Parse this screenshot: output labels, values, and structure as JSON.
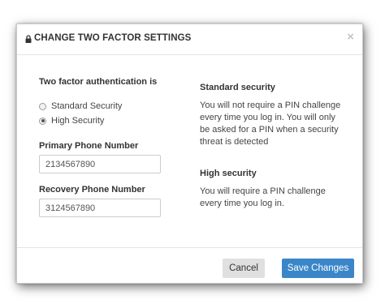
{
  "dialog": {
    "title": "CHANGE TWO FACTOR SETTINGS",
    "close_label": "×",
    "lock_icon": "lock-icon"
  },
  "form": {
    "auth_heading": "Two factor authentication is",
    "options": [
      {
        "label": "Standard Security",
        "selected": false
      },
      {
        "label": "High Security",
        "selected": true
      }
    ],
    "primary_phone": {
      "label": "Primary Phone Number",
      "value": "2134567890"
    },
    "recovery_phone": {
      "label": "Recovery Phone Number",
      "value": "3124567890"
    }
  },
  "info": {
    "standard": {
      "heading": "Standard security",
      "text": "You will not require a PIN challenge every time you log in. You will only be asked for a PIN when a security threat is detected"
    },
    "high": {
      "heading": "High security",
      "text": "You will require a PIN challenge every time you log in."
    }
  },
  "footer": {
    "cancel_label": "Cancel",
    "save_label": "Save Changes"
  },
  "colors": {
    "primary_button": "#3a86c8",
    "cancel_button": "#e0e0e0"
  }
}
